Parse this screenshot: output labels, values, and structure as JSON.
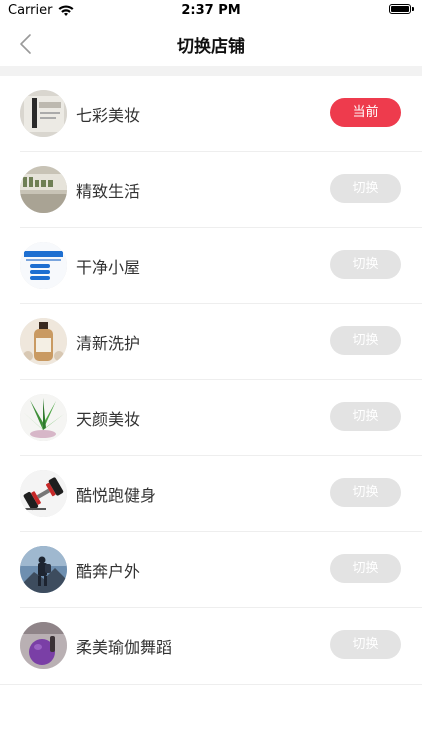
{
  "status_bar": {
    "carrier": "Carrier",
    "time": "2:37 PM"
  },
  "nav": {
    "title": "切换店铺"
  },
  "colors": {
    "current_button": "#ee3b4d",
    "inactive_button": "#e3e3e3"
  },
  "stores": [
    {
      "name": "七彩美妆",
      "button": "当前",
      "is_current": true,
      "icon": "office-product-thumbnail"
    },
    {
      "name": "精致生活",
      "button": "切换",
      "is_current": false,
      "icon": "office-sign-thumbnail"
    },
    {
      "name": "干净小屋",
      "button": "切换",
      "is_current": false,
      "icon": "disinfectant-poster-thumbnail"
    },
    {
      "name": "清新洗护",
      "button": "切换",
      "is_current": false,
      "icon": "shampoo-bottle-thumbnail"
    },
    {
      "name": "天颜美妆",
      "button": "切换",
      "is_current": false,
      "icon": "aloe-plant-thumbnail"
    },
    {
      "name": "酷悦跑健身",
      "button": "切换",
      "is_current": false,
      "icon": "dumbbell-thumbnail"
    },
    {
      "name": "酷奔户外",
      "button": "切换",
      "is_current": false,
      "icon": "hiker-thumbnail"
    },
    {
      "name": "柔美瑜伽舞蹈",
      "button": "切换",
      "is_current": false,
      "icon": "yoga-ball-thumbnail"
    }
  ]
}
